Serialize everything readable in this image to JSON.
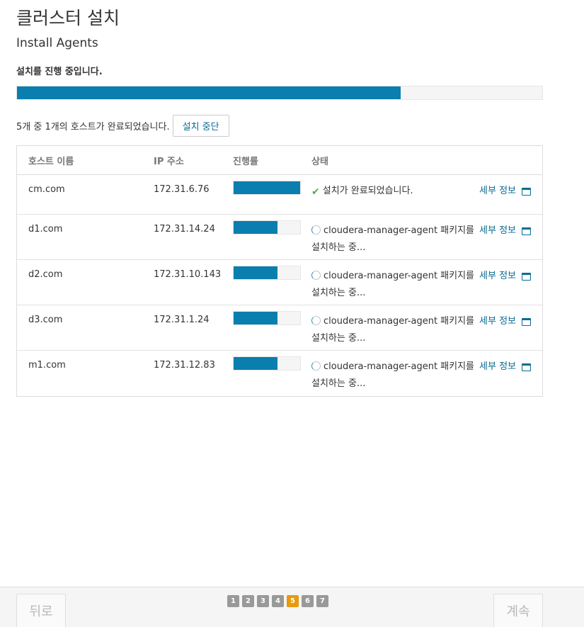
{
  "page": {
    "title": "클러스터 설치",
    "subtitle": "Install Agents",
    "progress_label": "설치를 진행 중입니다.",
    "overall_progress": 0.73
  },
  "summary": {
    "text": "5개 중 1개의 호스트가 완료되었습니다.",
    "abort_label": "설치 중단"
  },
  "table": {
    "headers": {
      "name": "호스트 이름",
      "ip": "IP 주소",
      "progress": "진행률",
      "status": "상태"
    },
    "rows": [
      {
        "name": "cm.com",
        "ip": "172.31.6.76",
        "progress": 1.0,
        "status": "설치가 완료되었습니다.",
        "state": "done",
        "details_label": "세부 정보"
      },
      {
        "name": "d1.com",
        "ip": "172.31.14.24",
        "progress": 0.66,
        "status": "cloudera-manager-agent 패키지를 설치하는 중...",
        "state": "running",
        "details_label": "세부 정보"
      },
      {
        "name": "d2.com",
        "ip": "172.31.10.143",
        "progress": 0.66,
        "status": "cloudera-manager-agent 패키지를 설치하는 중...",
        "state": "running",
        "details_label": "세부 정보"
      },
      {
        "name": "d3.com",
        "ip": "172.31.1.24",
        "progress": 0.66,
        "status": "cloudera-manager-agent 패키지를 설치하는 중...",
        "state": "running",
        "details_label": "세부 정보"
      },
      {
        "name": "m1.com",
        "ip": "172.31.12.83",
        "progress": 0.66,
        "status": "cloudera-manager-agent 패키지를 설치하는 중...",
        "state": "running",
        "details_label": "세부 정보"
      }
    ]
  },
  "footer": {
    "back_label": "뒤로",
    "continue_label": "계속",
    "steps": [
      "1",
      "2",
      "3",
      "4",
      "5",
      "6",
      "7"
    ],
    "active_step": 5
  },
  "colors": {
    "progress_fill": "#0a7eae",
    "link": "#0a6b94",
    "check": "#4caf50",
    "active_step": "#e89a0b",
    "inactive_step": "#999999"
  }
}
